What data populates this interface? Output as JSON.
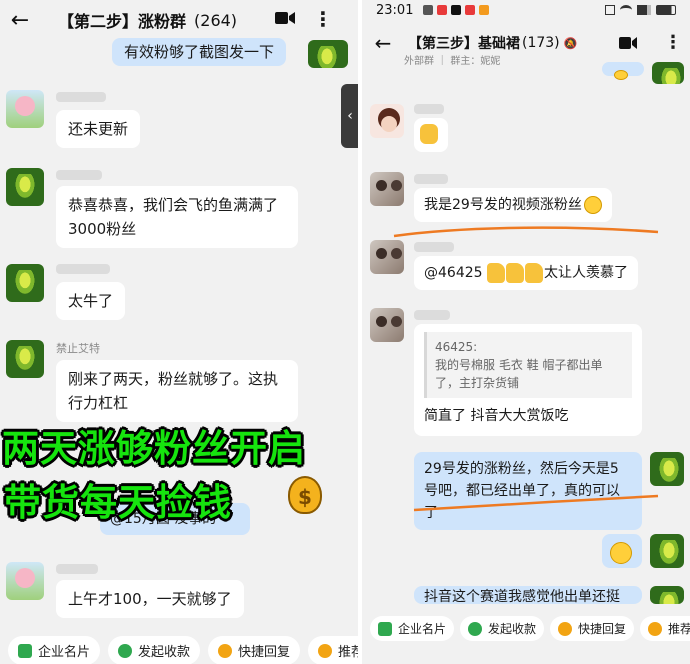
{
  "left": {
    "title": "【第二步】涨粉群",
    "count": "(264)",
    "top_bubble": "有效粉够了截图发一下",
    "messages": [
      {
        "name": "",
        "text": "还未更新"
      },
      {
        "name": "",
        "text": "恭喜恭喜，我们会飞的鱼满满了3000粉丝"
      },
      {
        "name": "",
        "text": "太牛了"
      },
      {
        "name": "禁止艾特",
        "text": "刚来了两天，粉丝就够了。这执行力杠杠"
      },
      {
        "name": "",
        "text": "上午才100，一天就够了"
      }
    ],
    "hidden_bubble": "@15月圆 没事的",
    "overlay_line1": "两天涨够粉丝开启",
    "overlay_line2": "带货每天捡钱",
    "moneybag_symbol": "$",
    "quick": [
      "企业名片",
      "发起收款",
      "快捷回复",
      "推荐"
    ]
  },
  "right": {
    "status_time": "23:01",
    "title": "【第三步】基础裙",
    "count": "(173)",
    "subtitle": "外部群 ｜ 群主：妮妮",
    "messages": [
      {
        "text": "我是29号发的视频涨粉丝"
      },
      {
        "text": "@46425"
      },
      {
        "text_after": "太让人羡慕了"
      },
      {
        "quote_name": "46425:",
        "quote_text": "我的号棉服 毛衣 鞋 帽子都出单了，主打杂货铺",
        "text": "简直了 抖音大大赏饭吃"
      },
      {
        "text": "29号发的涨粉丝，然后今天是5号吧，都已经出单了，真的可以了"
      },
      {
        "text": "抖音这个赛道我感觉他出单还挺"
      }
    ],
    "quick": [
      "企业名片",
      "发起收款",
      "快捷回复",
      "推荐客"
    ]
  },
  "colors": {
    "overlay_green": "#16e40e",
    "bubble_mine": "#cfe4fb",
    "underline": "#ee7a22"
  }
}
